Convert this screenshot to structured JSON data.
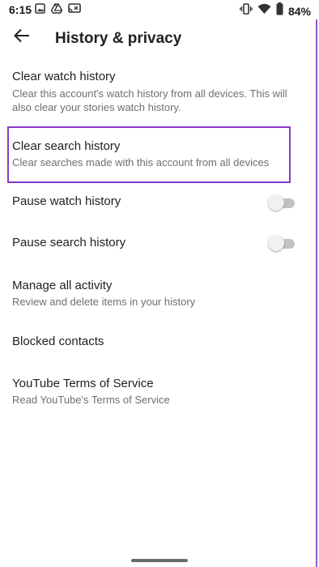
{
  "status_bar": {
    "time": "6:15",
    "left_icons": [
      "image-icon",
      "drive-icon",
      "cast-icon"
    ],
    "right_icons": [
      "vibrate-icon",
      "wifi-icon",
      "battery-icon"
    ],
    "battery_percent": "84%"
  },
  "header": {
    "back_icon": "arrow-left-icon",
    "title": "History & privacy"
  },
  "settings": {
    "clear_watch_history": {
      "title": "Clear watch history",
      "subtitle": "Clear this account's watch history from all devices. This will also clear your stories watch history."
    },
    "clear_search_history": {
      "title": "Clear search history",
      "subtitle": "Clear searches made with this account from all devices",
      "highlighted": true,
      "highlight_color": "#8a38c8"
    },
    "pause_watch_history": {
      "title": "Pause watch history",
      "enabled": false
    },
    "pause_search_history": {
      "title": "Pause search history",
      "enabled": false
    },
    "manage_all_activity": {
      "title": "Manage all activity",
      "subtitle": "Review and delete items in your history"
    },
    "blocked_contacts": {
      "title": "Blocked contacts"
    },
    "terms_of_service": {
      "title": "YouTube Terms of Service",
      "subtitle": "Read YouTube's Terms of Service"
    }
  }
}
